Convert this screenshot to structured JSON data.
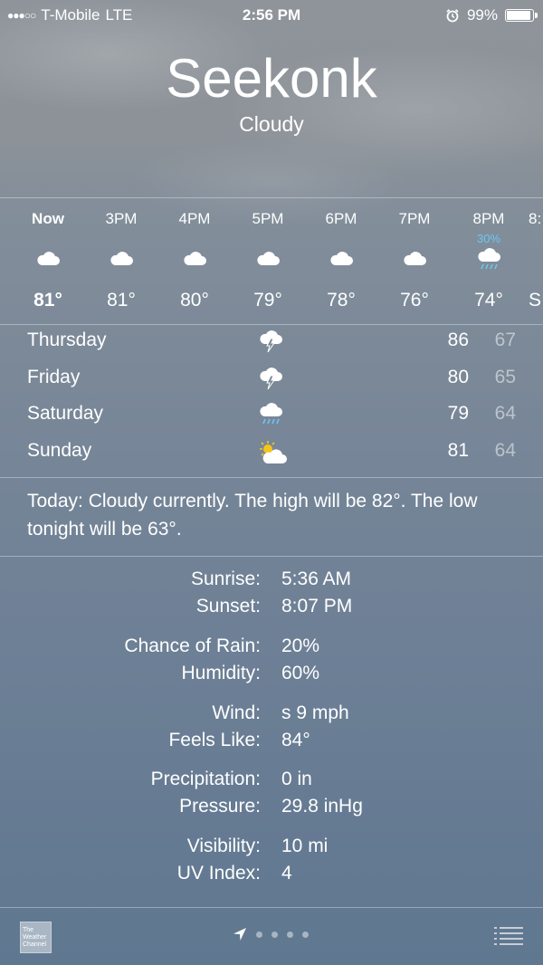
{
  "status": {
    "carrier": "T-Mobile",
    "network": "LTE",
    "time": "2:56 PM",
    "battery": "99%",
    "battery_level": 0.99,
    "signal_bars": 3,
    "icons": [
      "alarm-icon",
      "battery-icon"
    ]
  },
  "location": {
    "city": "Seekonk",
    "condition": "Cloudy"
  },
  "hourly": [
    {
      "label": "Now",
      "pop": "",
      "icon": "cloud-icon",
      "temp": "81°"
    },
    {
      "label": "3PM",
      "pop": "",
      "icon": "cloud-icon",
      "temp": "81°"
    },
    {
      "label": "4PM",
      "pop": "",
      "icon": "cloud-icon",
      "temp": "80°"
    },
    {
      "label": "5PM",
      "pop": "",
      "icon": "cloud-icon",
      "temp": "79°"
    },
    {
      "label": "6PM",
      "pop": "",
      "icon": "cloud-icon",
      "temp": "78°"
    },
    {
      "label": "7PM",
      "pop": "",
      "icon": "cloud-icon",
      "temp": "76°"
    },
    {
      "label": "8PM",
      "pop": "30%",
      "icon": "rain-cloud-icon",
      "temp": "74°"
    },
    {
      "label": "8:",
      "pop": "",
      "icon": "",
      "temp": "S"
    }
  ],
  "daily": [
    {
      "day": "Thursday",
      "icon": "thunderstorm-icon",
      "high": "86",
      "low": "67"
    },
    {
      "day": "Friday",
      "icon": "thunderstorm-icon",
      "high": "80",
      "low": "65"
    },
    {
      "day": "Saturday",
      "icon": "rain-cloud-icon",
      "high": "79",
      "low": "64"
    },
    {
      "day": "Sunday",
      "icon": "partly-sunny-icon",
      "high": "81",
      "low": "64"
    }
  ],
  "summary": "Today: Cloudy currently. The high will be 82°. The low tonight will be 63°.",
  "details": {
    "sunrise_label": "Sunrise:",
    "sunrise": "5:36 AM",
    "sunset_label": "Sunset:",
    "sunset": "8:07 PM",
    "rain_label": "Chance of Rain:",
    "rain": "20%",
    "humidity_label": "Humidity:",
    "humidity": "60%",
    "wind_label": "Wind:",
    "wind": "s 9 mph",
    "feels_label": "Feels Like:",
    "feels": "84°",
    "precip_label": "Precipitation:",
    "precip": "0 in",
    "pressure_label": "Pressure:",
    "pressure": "29.8 inHg",
    "visibility_label": "Visibility:",
    "visibility": "10 mi",
    "uv_label": "UV Index:",
    "uv": "4"
  },
  "bottom": {
    "logo_text": "The Weather Channel",
    "page_count": 4,
    "current_page": "location"
  },
  "colors": {
    "pop": "#6ac8f5",
    "sun": "#f5c518"
  }
}
